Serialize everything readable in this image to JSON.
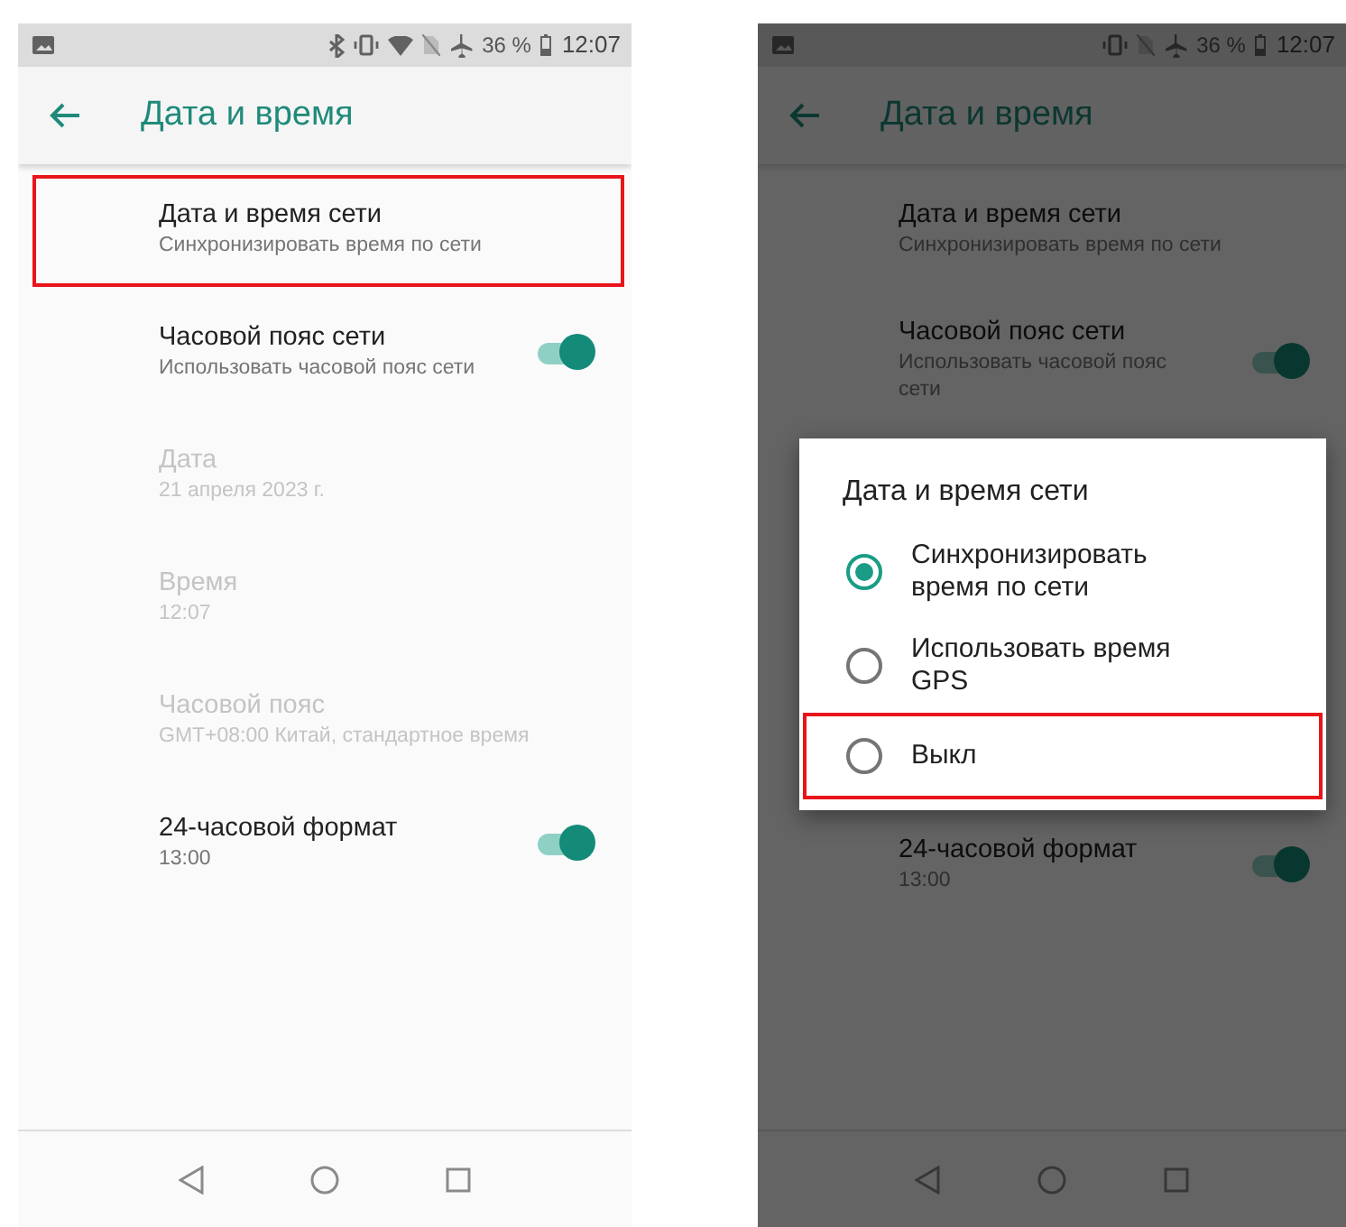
{
  "screens": [
    {
      "dimmed": false,
      "status_bar": {
        "bluetooth": true,
        "wifi": true,
        "battery": "36 %",
        "time": "12:07"
      },
      "title": "Дата и время",
      "rows": [
        {
          "title": "Дата и время сети",
          "subtitle": "Синхронизировать время по сети",
          "disabled": false,
          "highlighted": true
        },
        {
          "title": "Часовой пояс сети",
          "subtitle": "Использовать часовой пояс сети",
          "disabled": false,
          "highlighted": false,
          "toggle": {
            "on": true
          }
        },
        {
          "title": "Дата",
          "subtitle": "21 апреля 2023 г.",
          "disabled": true,
          "highlighted": false
        },
        {
          "title": "Время",
          "subtitle": "12:07",
          "disabled": true,
          "highlighted": false
        },
        {
          "title": "Часовой пояс",
          "subtitle": "GMT+08:00 Китай, стандартное время",
          "disabled": true,
          "highlighted": false
        },
        {
          "title": "24-часовой формат",
          "subtitle": "13:00",
          "disabled": false,
          "highlighted": false,
          "toggle": {
            "on": true
          }
        }
      ]
    },
    {
      "dimmed": true,
      "status_bar": {
        "bluetooth": false,
        "wifi": false,
        "battery": "36 %",
        "time": "12:07"
      },
      "title": "Дата и время",
      "rows": [
        {
          "title": "Дата и время сети",
          "subtitle": "Синхронизировать время по сети",
          "disabled": false,
          "highlighted": false
        },
        {
          "title": "Часовой пояс сети",
          "subtitle": "Использовать часовой пояс сети",
          "disabled": false,
          "highlighted": false,
          "toggle": {
            "on": true
          }
        },
        {
          "title": "24-часовой формат",
          "subtitle": "13:00",
          "disabled": false,
          "highlighted": false,
          "toggle": {
            "on": true
          }
        }
      ],
      "dialog": {
        "title": "Дата и время сети",
        "options": [
          {
            "label": "Синхронизировать время по сети",
            "selected": true,
            "highlighted": false
          },
          {
            "label": "Использовать время GPS",
            "selected": false,
            "highlighted": false
          },
          {
            "label": "Выкл",
            "selected": false,
            "highlighted": true
          }
        ]
      }
    }
  ]
}
